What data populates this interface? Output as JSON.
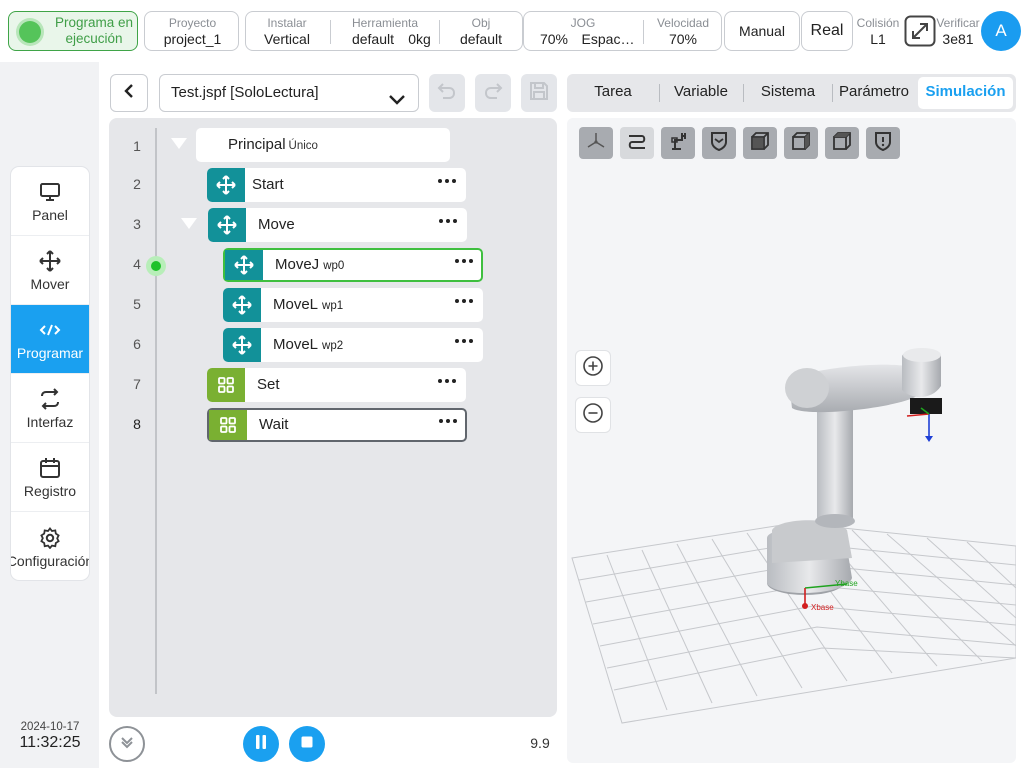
{
  "topbar": {
    "status_text": "Programa en ejecución",
    "project": {
      "label": "Proyecto",
      "value": "project_1"
    },
    "install": {
      "label": "Instalar",
      "value": "Vertical"
    },
    "tool": {
      "label": "Herramienta",
      "value": "default",
      "weight": "0kg"
    },
    "obj": {
      "label": "Obj",
      "value": "default"
    },
    "jog": {
      "label": "JOG",
      "value": "70%",
      "space": "Espac…"
    },
    "speed": {
      "label": "Velocidad",
      "value": "70%"
    },
    "mode_manual": "Manual",
    "mode_real": "Real",
    "collision": {
      "label": "Colisión",
      "value": "L1"
    },
    "verify": {
      "label": "Verificar",
      "value": "3e81"
    },
    "avatar": "A"
  },
  "sidebar": {
    "items": [
      {
        "label": "Panel",
        "icon": "monitor-icon"
      },
      {
        "label": "Mover",
        "icon": "move-icon"
      },
      {
        "label": "Programar",
        "icon": "code-icon",
        "active": true
      },
      {
        "label": "Interfaz",
        "icon": "interface-icon"
      },
      {
        "label": "Registro",
        "icon": "calendar-icon"
      },
      {
        "label": "Configuración",
        "icon": "gear-icon"
      }
    ],
    "date": "2024-10-17",
    "time": "11:32:25"
  },
  "editor": {
    "file": "Test.jspf [SoloLectura]",
    "line_numbers": [
      "1",
      "2",
      "3",
      "4",
      "5",
      "6",
      "7",
      "8"
    ],
    "root": {
      "label": "Principal",
      "sub": "Único"
    },
    "nodes": [
      {
        "label": "Start",
        "sub": ""
      },
      {
        "label": "Move",
        "sub": ""
      },
      {
        "label": "MoveJ",
        "sub": "wp0"
      },
      {
        "label": "MoveL",
        "sub": "wp1"
      },
      {
        "label": "MoveL",
        "sub": "wp2"
      },
      {
        "label": "Set",
        "sub": ""
      },
      {
        "label": "Wait",
        "sub": ""
      }
    ],
    "speed_value": "9.9"
  },
  "panel": {
    "tabs": [
      "Tarea",
      "Variable",
      "Sistema",
      "Parámetro",
      "Simulación"
    ],
    "active_tab": "Simulación",
    "axis_labels": {
      "x": "Xbase",
      "y": "Ybase"
    }
  },
  "colors": {
    "accent": "#1aa0f0",
    "running_green": "#3fa447",
    "move_teal": "#129199",
    "io_lime": "#7ab032"
  }
}
